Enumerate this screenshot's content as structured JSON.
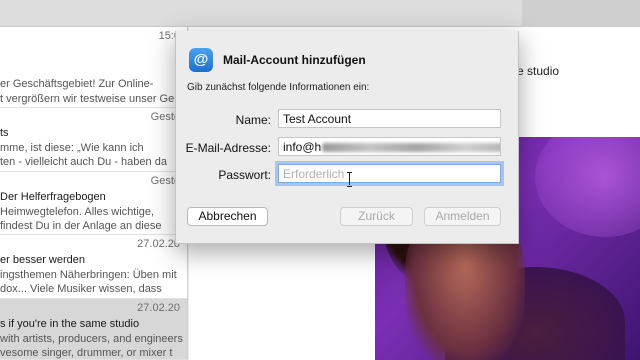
{
  "window": {
    "title_area": ""
  },
  "message_list": {
    "items": [
      {
        "date": "15:0",
        "subject": "",
        "preview_lines": [
          "er Geschäftsgebiet! Zur Online-",
          "t vergrößern wir testweise unser Ge"
        ]
      },
      {
        "date": "Geste",
        "subject": "ts",
        "preview_lines": [
          "mme, ist diese: „Wie kann ich",
          "ten - vielleicht auch Du - haben da"
        ]
      },
      {
        "date": "Geste",
        "subject": "Der Helferfragebogen",
        "preview_lines": [
          "Heimwegtelefon. Alles wichtige,",
          "findest Du in der Anlage an diese"
        ]
      },
      {
        "date": "27.02.20",
        "subject": "er besser werden",
        "preview_lines": [
          "ingsthemen Näherbringen: Üben mit",
          "dox... Viele Musiker wissen, dass"
        ]
      },
      {
        "date": "27.02.20",
        "subject": "s if you're in the same studio",
        "preview_lines": [
          "with artists, producers, and engineers",
          "vesome singer, drummer, or mixer t"
        ]
      }
    ]
  },
  "reading_pane": {
    "subject_fragment": "e studio"
  },
  "dialog": {
    "icon": "@",
    "title": "Mail-Account hinzufügen",
    "intro": "Gib zunächst folgende Informationen ein:",
    "name_label": "Name:",
    "name_value": "Test Account",
    "email_label": "E-Mail-Adresse:",
    "email_value_visible": "info@h",
    "password_label": "Passwort:",
    "password_placeholder": "Erforderlich",
    "cancel_label": "Abbrechen",
    "back_label": "Zurück",
    "signin_label": "Anmelden"
  },
  "colors": {
    "accent": "#1d6fd1",
    "hero_purple": "#5a1f8c"
  }
}
